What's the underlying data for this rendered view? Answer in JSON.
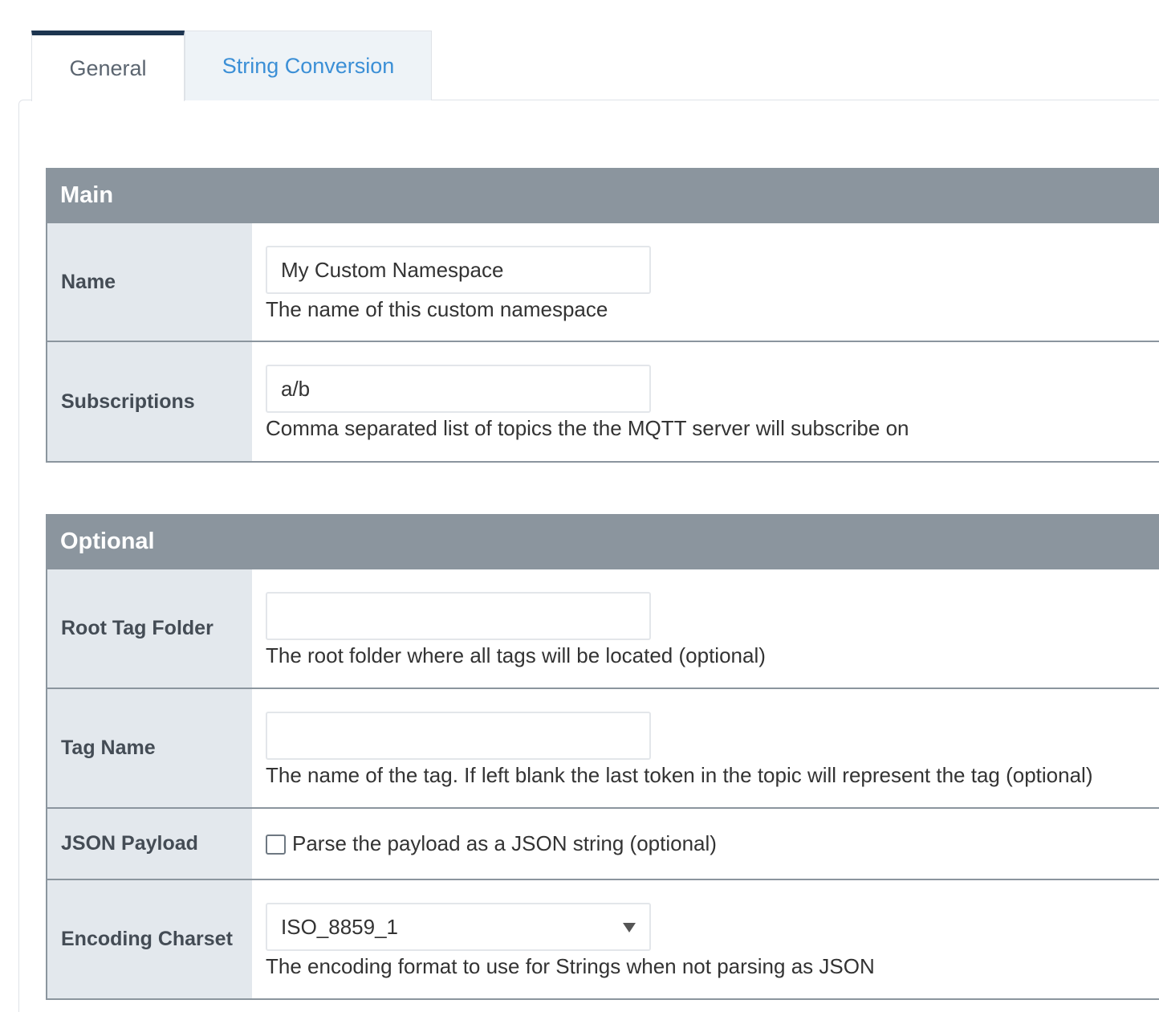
{
  "tabs": [
    {
      "label": "General",
      "active": true
    },
    {
      "label": "String Conversion",
      "active": false
    }
  ],
  "sections": {
    "main": {
      "title": "Main",
      "name": {
        "label": "Name",
        "value": "My Custom Namespace",
        "help": "The name of this custom namespace"
      },
      "subscriptions": {
        "label": "Subscriptions",
        "value": "a/b",
        "help": "Comma separated list of topics the the MQTT server will subscribe on"
      }
    },
    "optional": {
      "title": "Optional",
      "root_tag_folder": {
        "label": "Root Tag Folder",
        "value": "",
        "help": "The root folder where all tags will be located (optional)"
      },
      "tag_name": {
        "label": "Tag Name",
        "value": "",
        "help": "The name of the tag. If left blank the last token in the topic will represent the tag (optional)"
      },
      "json_payload": {
        "label": "JSON Payload",
        "checked": false,
        "checkbox_label": "Parse the payload as a JSON string (optional)"
      },
      "encoding_charset": {
        "label": "Encoding Charset",
        "selected": "ISO_8859_1",
        "help": "The encoding format to use for Strings when not parsing as JSON"
      }
    }
  },
  "colors": {
    "section_header_bg": "#8b959e",
    "label_bg": "#e3e8ed",
    "active_tab_border": "#1d3550",
    "inactive_tab_text": "#3b8fd6"
  }
}
